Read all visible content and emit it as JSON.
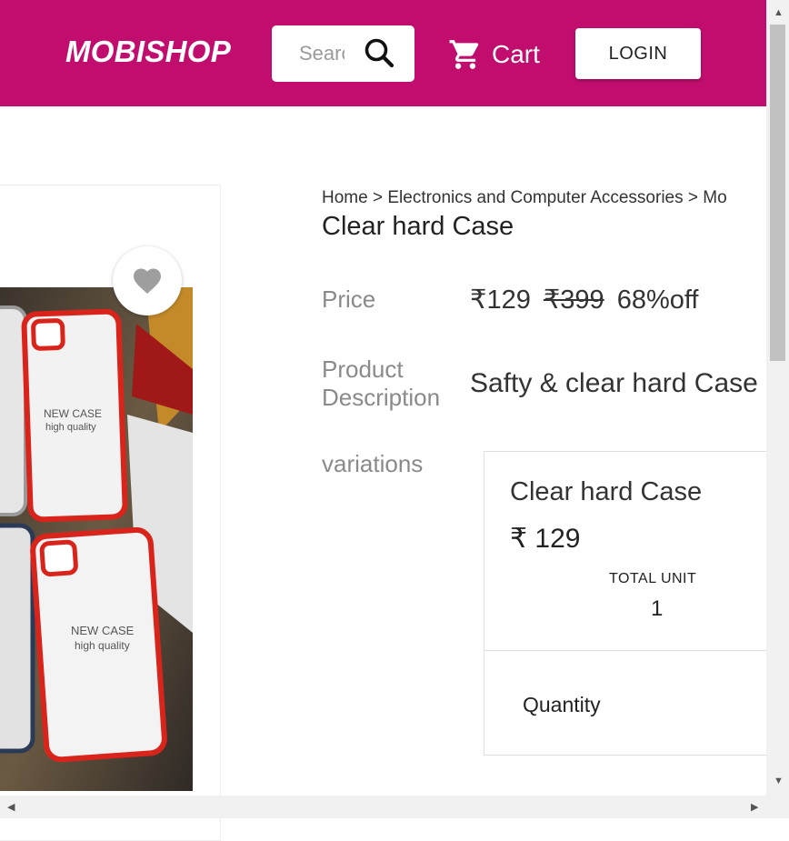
{
  "header": {
    "logo": "MOBISHOP",
    "search_placeholder": "Search",
    "cart_label": "Cart",
    "login_label": "LOGIN",
    "color": "#c10e6e"
  },
  "breadcrumb": {
    "items": [
      "Home",
      "Electronics and Computer Accessories",
      "Mo"
    ],
    "separator": ">"
  },
  "product": {
    "title": "Clear hard Case",
    "price_label": "Price",
    "price": "₹129",
    "mrp": "₹399",
    "discount": "68%off",
    "description_label_line1": "Product",
    "description_label_line2": "Description",
    "description": "Safty & clear hard Case"
  },
  "variations": {
    "label": "variations",
    "card": {
      "name": "Clear hard Case",
      "price": "₹ 129",
      "unit_label": "TOTAL UNIT",
      "unit_value": "1",
      "quantity_label": "Quantity"
    }
  },
  "image": {
    "case_text_line1": "NEW CASE",
    "case_text_line2": "high quality"
  },
  "icons": {
    "search": "search-icon",
    "cart": "cart-icon",
    "favorite": "heart-icon"
  }
}
